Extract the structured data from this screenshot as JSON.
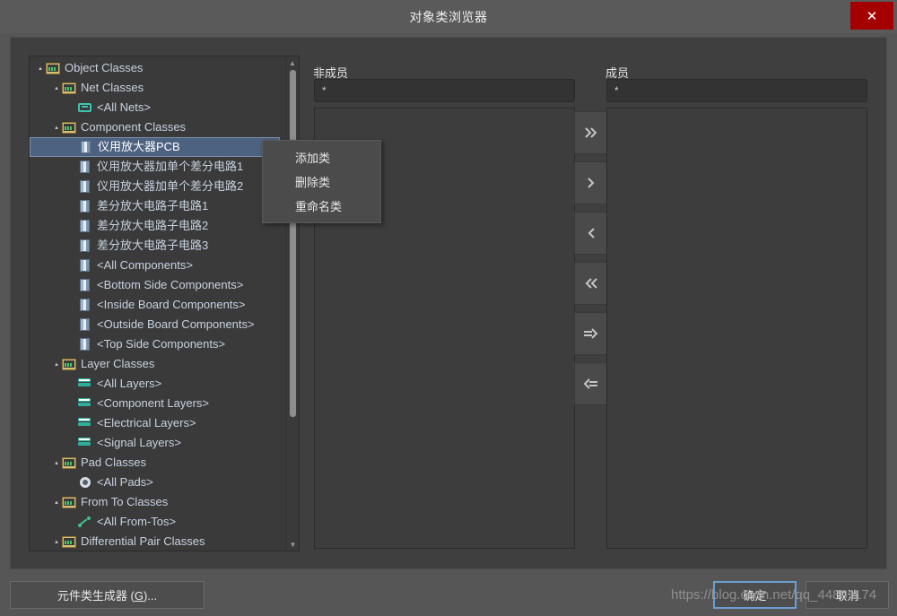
{
  "window": {
    "title": "对象类浏览器",
    "close_label": "✕",
    "accent_close": "#a50000",
    "accent_selection": "#4c6280",
    "accent_focus": "#6b9fd4"
  },
  "tree": {
    "items": [
      {
        "label": "Object Classes",
        "indent": 0,
        "icon": "folder-icon",
        "twisty": "▴",
        "selected": false
      },
      {
        "label": "Net Classes",
        "indent": 1,
        "icon": "folder-icon",
        "twisty": "▴",
        "selected": false
      },
      {
        "label": "<All Nets>",
        "indent": 2,
        "icon": "net-icon",
        "twisty": "",
        "selected": false
      },
      {
        "label": "Component Classes",
        "indent": 1,
        "icon": "folder-icon",
        "twisty": "▴",
        "selected": false
      },
      {
        "label": "仪用放大器PCB",
        "indent": 2,
        "icon": "component-icon",
        "twisty": "",
        "selected": true
      },
      {
        "label": "仪用放大器加单个差分电路1",
        "indent": 2,
        "icon": "component-icon",
        "twisty": "",
        "selected": false
      },
      {
        "label": "仪用放大器加单个差分电路2",
        "indent": 2,
        "icon": "component-icon",
        "twisty": "",
        "selected": false
      },
      {
        "label": "差分放大电路子电路1",
        "indent": 2,
        "icon": "component-icon",
        "twisty": "",
        "selected": false
      },
      {
        "label": "差分放大电路子电路2",
        "indent": 2,
        "icon": "component-icon",
        "twisty": "",
        "selected": false
      },
      {
        "label": "差分放大电路子电路3",
        "indent": 2,
        "icon": "component-icon",
        "twisty": "",
        "selected": false
      },
      {
        "label": "<All Components>",
        "indent": 2,
        "icon": "component-icon",
        "twisty": "",
        "selected": false
      },
      {
        "label": "<Bottom Side Components>",
        "indent": 2,
        "icon": "component-icon",
        "twisty": "",
        "selected": false
      },
      {
        "label": "<Inside Board Components>",
        "indent": 2,
        "icon": "component-icon",
        "twisty": "",
        "selected": false
      },
      {
        "label": "<Outside Board Components>",
        "indent": 2,
        "icon": "component-icon",
        "twisty": "",
        "selected": false
      },
      {
        "label": "<Top Side Components>",
        "indent": 2,
        "icon": "component-icon",
        "twisty": "",
        "selected": false
      },
      {
        "label": "Layer Classes",
        "indent": 1,
        "icon": "folder-icon",
        "twisty": "▴",
        "selected": false
      },
      {
        "label": "<All Layers>",
        "indent": 2,
        "icon": "layer-icon",
        "twisty": "",
        "selected": false
      },
      {
        "label": "<Component Layers>",
        "indent": 2,
        "icon": "layer-icon",
        "twisty": "",
        "selected": false
      },
      {
        "label": "<Electrical Layers>",
        "indent": 2,
        "icon": "layer-icon",
        "twisty": "",
        "selected": false
      },
      {
        "label": "<Signal Layers>",
        "indent": 2,
        "icon": "layer-icon",
        "twisty": "",
        "selected": false
      },
      {
        "label": "Pad Classes",
        "indent": 1,
        "icon": "folder-icon",
        "twisty": "▴",
        "selected": false
      },
      {
        "label": "<All Pads>",
        "indent": 2,
        "icon": "pad-icon",
        "twisty": "",
        "selected": false
      },
      {
        "label": "From To Classes",
        "indent": 1,
        "icon": "folder-icon",
        "twisty": "▴",
        "selected": false
      },
      {
        "label": "<All From-Tos>",
        "indent": 2,
        "icon": "fromto-icon",
        "twisty": "",
        "selected": false
      },
      {
        "label": "Differential Pair Classes",
        "indent": 1,
        "icon": "folder-icon",
        "twisty": "▴",
        "selected": false
      }
    ],
    "scroll_up": "▲",
    "scroll_down": "▼"
  },
  "context_menu": {
    "items": [
      {
        "label": "添加类"
      },
      {
        "label": "删除类"
      },
      {
        "label": "重命名类"
      }
    ]
  },
  "non_members": {
    "title": "非成员",
    "filter_value": "*",
    "filter_placeholder": "*",
    "items": []
  },
  "members": {
    "title": "成员",
    "filter_value": "*",
    "filter_placeholder": "*",
    "items": []
  },
  "transfer_buttons": [
    {
      "name": "move-all-right-button",
      "glyph": "»"
    },
    {
      "name": "move-right-button",
      "glyph": "›"
    },
    {
      "name": "move-left-button",
      "glyph": "‹"
    },
    {
      "name": "move-all-left-button",
      "glyph": "«"
    },
    {
      "name": "move-matching-right-button",
      "glyph": "⇛"
    },
    {
      "name": "move-matching-left-button",
      "glyph": "⇚"
    }
  ],
  "footer": {
    "generator_label": "元件类生成器 (G)...",
    "generator_accel": "G",
    "ok_label": "确定",
    "cancel_label": "取消"
  },
  "watermark": {
    "text": "https://blog.csdn.net/qq_44861174"
  }
}
